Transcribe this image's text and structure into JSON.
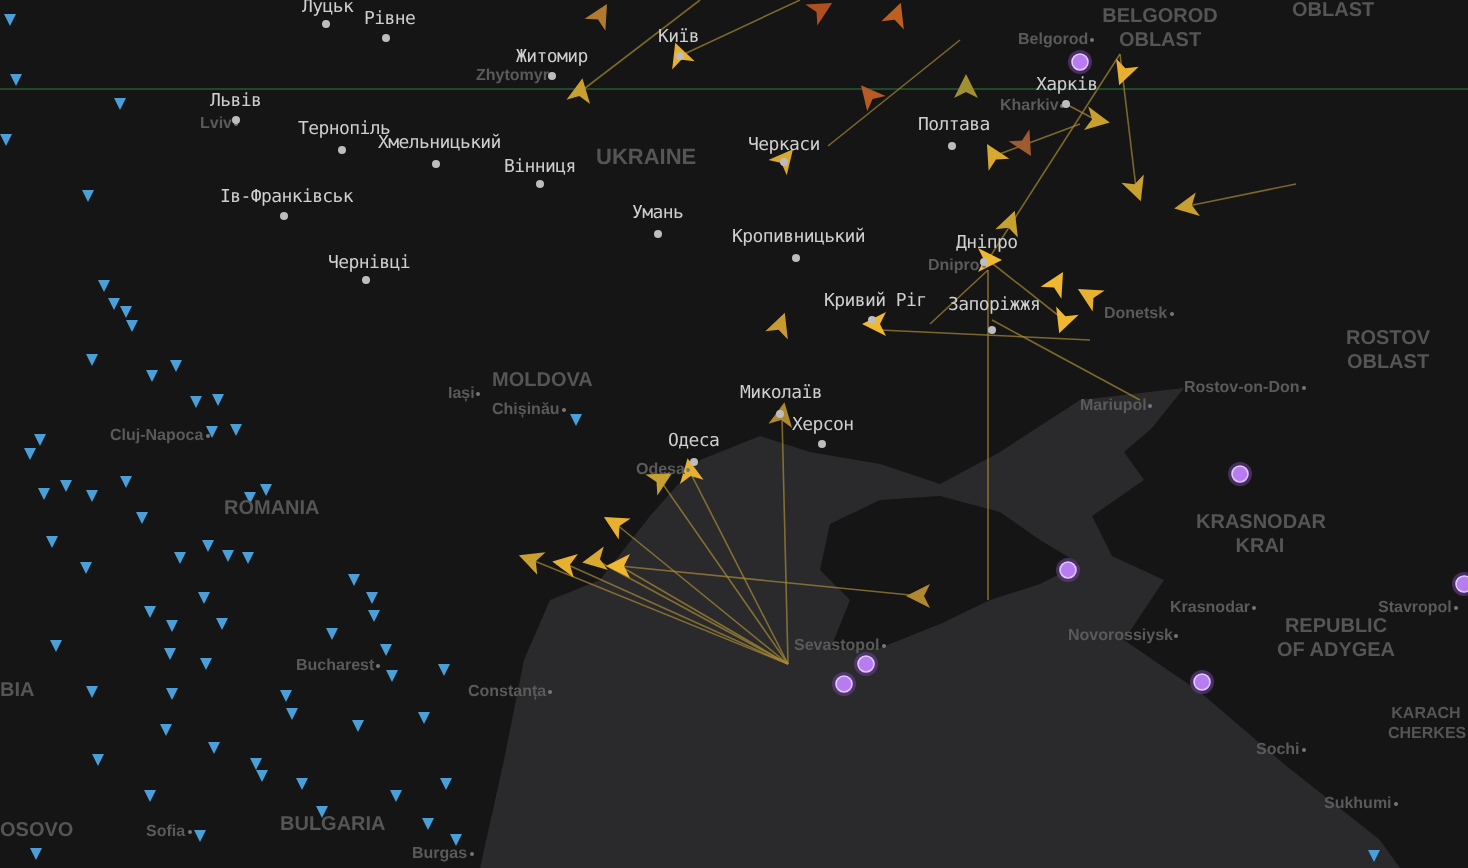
{
  "map": {
    "region_labels": [
      "UKRAINE",
      "BELGOROD OBLAST",
      "OBLAST",
      "ROSTOV OBLAST",
      "MOLDOVA",
      "ROMANIA",
      "BULGARIA",
      "BIA",
      "OSOVO",
      "KRASNODAR KRAI",
      "REPUBLIC OF ADYGEA",
      "KARACH CHERKES"
    ],
    "place_labels": [
      "Zhytomyr",
      "Lviv",
      "Belgorod",
      "Kharkiv",
      "Dnipro",
      "Iași",
      "Chișinău",
      "Cluj-Napoca",
      "Odesa",
      "Bucharest",
      "Constanța",
      "Sevastopol",
      "Sofia",
      "Burgas",
      "Donetsk",
      "Mariupol",
      "Rostov-on-Don",
      "Krasnodar",
      "Novorossiysk",
      "Stavropol",
      "Sochi",
      "Sukhumi"
    ],
    "city_labels": [
      "Луцьк",
      "Рівне",
      "Житомир",
      "Київ",
      "Львів",
      "Тернопіль",
      "Хмельницький",
      "Вінниця",
      "Ів-Франківськ",
      "Черкаси",
      "Полтава",
      "Харків",
      "Умань",
      "Кропивницький",
      "Дніпро",
      "Чернівці",
      "Кривий Ріг",
      "Запоріжжя",
      "Миколаїв",
      "Херсон",
      "Одеса"
    ]
  }
}
